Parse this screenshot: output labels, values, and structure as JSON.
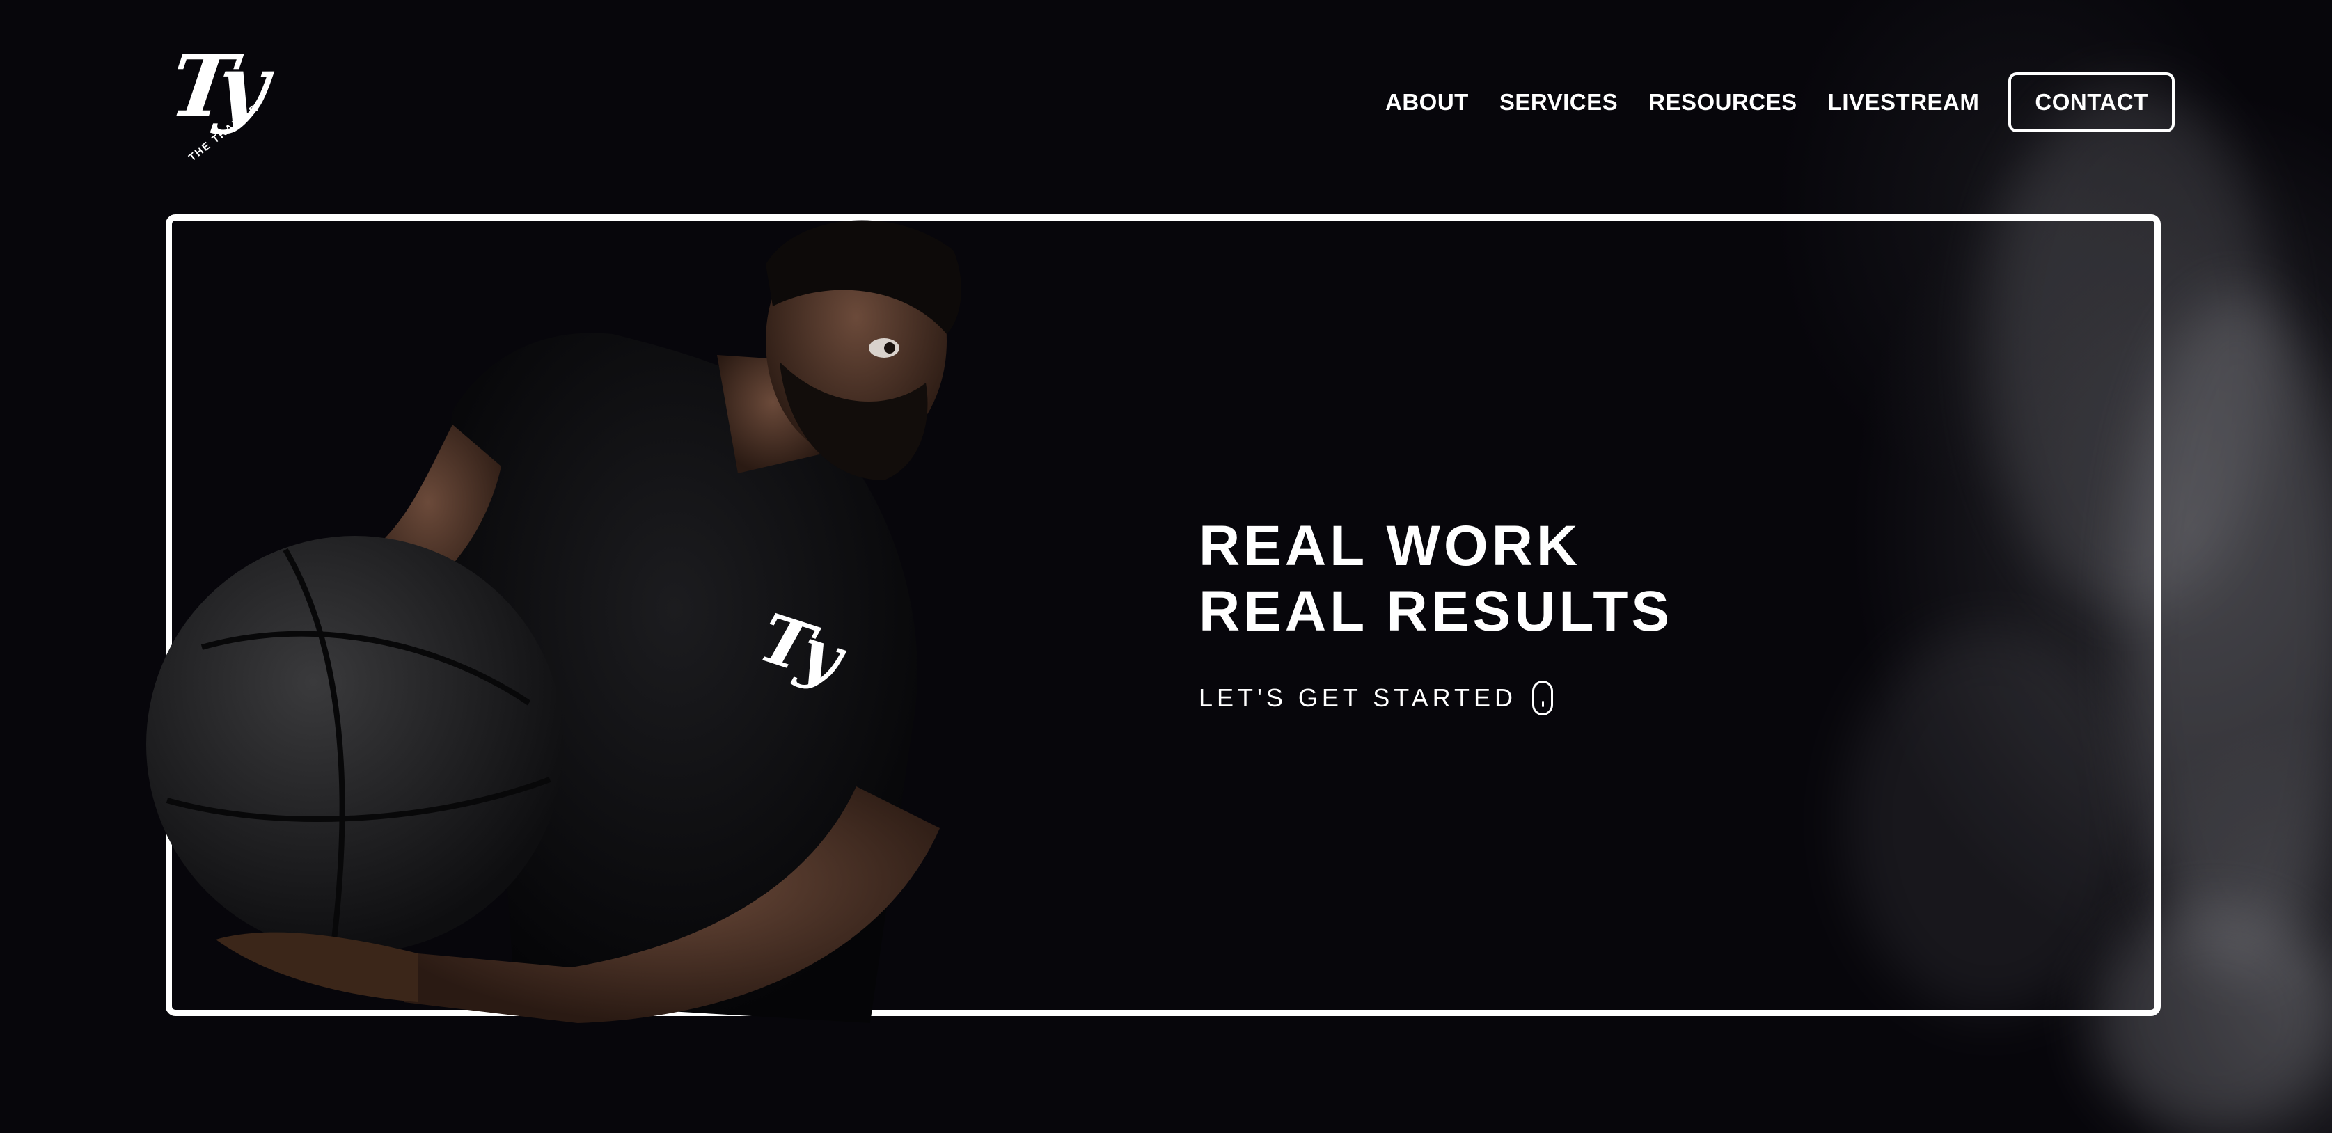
{
  "brand": {
    "logo_mark": "Ty",
    "logo_subtitle": "THE TRAINER"
  },
  "nav": {
    "items": [
      {
        "label": "ABOUT"
      },
      {
        "label": "SERVICES"
      },
      {
        "label": "RESOURCES"
      },
      {
        "label": "LIVESTREAM"
      }
    ],
    "contact_label": "CONTACT"
  },
  "hero": {
    "title_line1": "REAL WORK",
    "title_line2": "REAL RESULTS",
    "cta_label": "LET'S GET STARTED",
    "cta_icon": "scroll-mouse-icon",
    "image_description_icon": "trainer-with-medicine-ball-photo"
  },
  "colors": {
    "background": "#07060b",
    "foreground": "#ffffff",
    "frame": "#ffffff"
  }
}
